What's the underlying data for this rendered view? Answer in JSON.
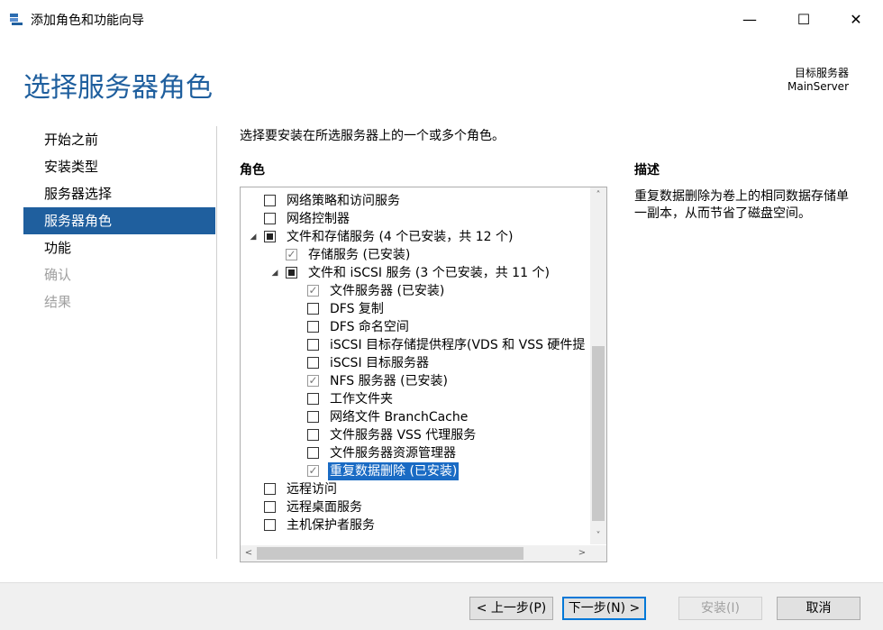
{
  "window": {
    "title": "添加角色和功能向导",
    "minimize_icon": "—",
    "maximize_icon": "☐",
    "close_icon": "✕"
  },
  "header": {
    "page_title": "选择服务器角色",
    "target_label": "目标服务器",
    "target_value": "MainServer"
  },
  "nav": {
    "items": [
      {
        "label": "开始之前",
        "state": "normal"
      },
      {
        "label": "安装类型",
        "state": "normal"
      },
      {
        "label": "服务器选择",
        "state": "normal"
      },
      {
        "label": "服务器角色",
        "state": "active"
      },
      {
        "label": "功能",
        "state": "normal"
      },
      {
        "label": "确认",
        "state": "disabled"
      },
      {
        "label": "结果",
        "state": "disabled"
      }
    ]
  },
  "main": {
    "instruction": "选择要安装在所选服务器上的一个或多个角色。",
    "roles_header": "角色",
    "description_header": "描述",
    "description_text": "重复数据删除为卷上的相同数据存储单一副本，从而节省了磁盘空间。"
  },
  "roles": [
    {
      "label": "网络策略和访问服务",
      "level": 0,
      "state": "unchecked",
      "expander": ""
    },
    {
      "label": "网络控制器",
      "level": 0,
      "state": "unchecked",
      "expander": ""
    },
    {
      "label": "文件和存储服务 (4 个已安装，共 12 个)",
      "level": 0,
      "state": "partial",
      "expander": "◢"
    },
    {
      "label": "存储服务 (已安装)",
      "level": 1,
      "state": "checked",
      "expander": ""
    },
    {
      "label": "文件和 iSCSI 服务 (3 个已安装，共 11 个)",
      "level": 1,
      "state": "partial",
      "expander": "◢"
    },
    {
      "label": "文件服务器 (已安装)",
      "level": 2,
      "state": "checked",
      "expander": ""
    },
    {
      "label": "DFS 复制",
      "level": 2,
      "state": "unchecked",
      "expander": ""
    },
    {
      "label": "DFS 命名空间",
      "level": 2,
      "state": "unchecked",
      "expander": ""
    },
    {
      "label": "iSCSI 目标存储提供程序(VDS 和 VSS 硬件提",
      "level": 2,
      "state": "unchecked",
      "expander": ""
    },
    {
      "label": "iSCSI 目标服务器",
      "level": 2,
      "state": "unchecked",
      "expander": ""
    },
    {
      "label": "NFS 服务器 (已安装)",
      "level": 2,
      "state": "checked",
      "expander": ""
    },
    {
      "label": "工作文件夹",
      "level": 2,
      "state": "unchecked",
      "expander": ""
    },
    {
      "label": "网络文件 BranchCache",
      "level": 2,
      "state": "unchecked",
      "expander": ""
    },
    {
      "label": "文件服务器 VSS 代理服务",
      "level": 2,
      "state": "unchecked",
      "expander": ""
    },
    {
      "label": "文件服务器资源管理器",
      "level": 2,
      "state": "unchecked",
      "expander": ""
    },
    {
      "label": "重复数据删除 (已安装)",
      "level": 2,
      "state": "checked",
      "expander": "",
      "selected": true
    },
    {
      "label": "远程访问",
      "level": 0,
      "state": "unchecked",
      "expander": ""
    },
    {
      "label": "远程桌面服务",
      "level": 0,
      "state": "unchecked",
      "expander": ""
    },
    {
      "label": "主机保护者服务",
      "level": 0,
      "state": "unchecked",
      "expander": ""
    }
  ],
  "scroll": {
    "up": "˄",
    "down": "˅",
    "left": "<",
    "right": ">"
  },
  "buttons": {
    "prev": "< 上一步(P)",
    "next": "下一步(N) >",
    "install": "安装(I)",
    "cancel": "取消"
  },
  "colors": {
    "accent": "#1f5f9e",
    "selection": "#1a6bc4"
  }
}
